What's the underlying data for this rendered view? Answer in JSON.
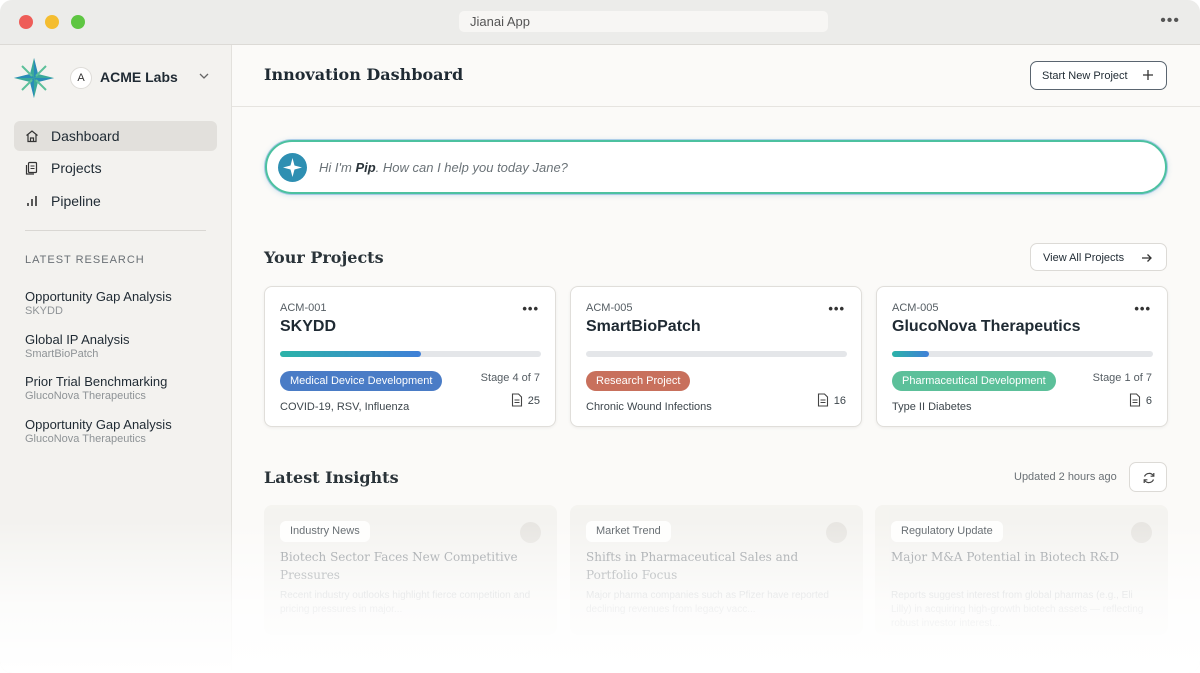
{
  "window": {
    "title": "Jianai App",
    "menu_icon": "ellipsis-icon"
  },
  "sidebar": {
    "org": {
      "avatar_letter": "A",
      "name": "ACME Labs"
    },
    "nav": [
      {
        "label": "Dashboard",
        "icon": "home-icon",
        "active": true
      },
      {
        "label": "Projects",
        "icon": "documents-icon",
        "active": false
      },
      {
        "label": "Pipeline",
        "icon": "bar-chart-icon",
        "active": false
      }
    ],
    "research_heading": "LATEST RESEARCH",
    "research": [
      {
        "title": "Opportunity Gap Analysis",
        "project": "SKYDD"
      },
      {
        "title": "Global IP Analysis",
        "project": "SmartBioPatch"
      },
      {
        "title": "Prior Trial Benchmarking",
        "project": "GlucoNova Therapeutics"
      },
      {
        "title": "Opportunity Gap Analysis",
        "project": "GlucoNova Therapeutics"
      }
    ]
  },
  "header": {
    "title": "Innovation Dashboard",
    "start_button": "Start New Project"
  },
  "assistant": {
    "prefix": "Hi I'm ",
    "name": "Pip",
    "suffix": ". How can I help you today Jane?"
  },
  "projects": {
    "heading": "Your Projects",
    "view_all": "View All Projects",
    "items": [
      {
        "code": "ACM-001",
        "name": "SKYDD",
        "progress": 0.54,
        "tag": "Medical Device Development",
        "tag_color": "#4a7cc6",
        "stage": "Stage 4 of 7",
        "area": "COVID-19, RSV, Influenza",
        "docs": "25"
      },
      {
        "code": "ACM-005",
        "name": "SmartBioPatch",
        "progress": 0,
        "tag": "Research Project",
        "tag_color": "#c8705c",
        "stage": "",
        "area": "Chronic Wound Infections",
        "docs": "16"
      },
      {
        "code": "ACM-005",
        "name": "GlucoNova Therapeutics",
        "progress": 0.14,
        "tag": "Pharmaceutical Development",
        "tag_color": "#5cc09a",
        "stage": "Stage 1 of 7",
        "area": "Type II Diabetes",
        "docs": "6"
      }
    ]
  },
  "insights": {
    "heading": "Latest Insights",
    "updated": "Updated 2 hours ago",
    "items": [
      {
        "tag": "Industry News",
        "title": "Biotech Sector Faces New Competitive Pressures",
        "body": "Recent industry outlooks highlight fierce competition and pricing pressures in major..."
      },
      {
        "tag": "Market Trend",
        "title": "Shifts in Pharmaceutical Sales and Portfolio Focus",
        "body": "Major pharma companies such as Pfizer have reported declining revenues from legacy vacc..."
      },
      {
        "tag": "Regulatory Update",
        "title": "Major M&A Potential in Biotech R&D",
        "body": "Reports suggest interest from global pharmas (e.g., Eli Lilly) in acquiring high-growth biotech assets — reflecting robust investor interest..."
      }
    ]
  }
}
